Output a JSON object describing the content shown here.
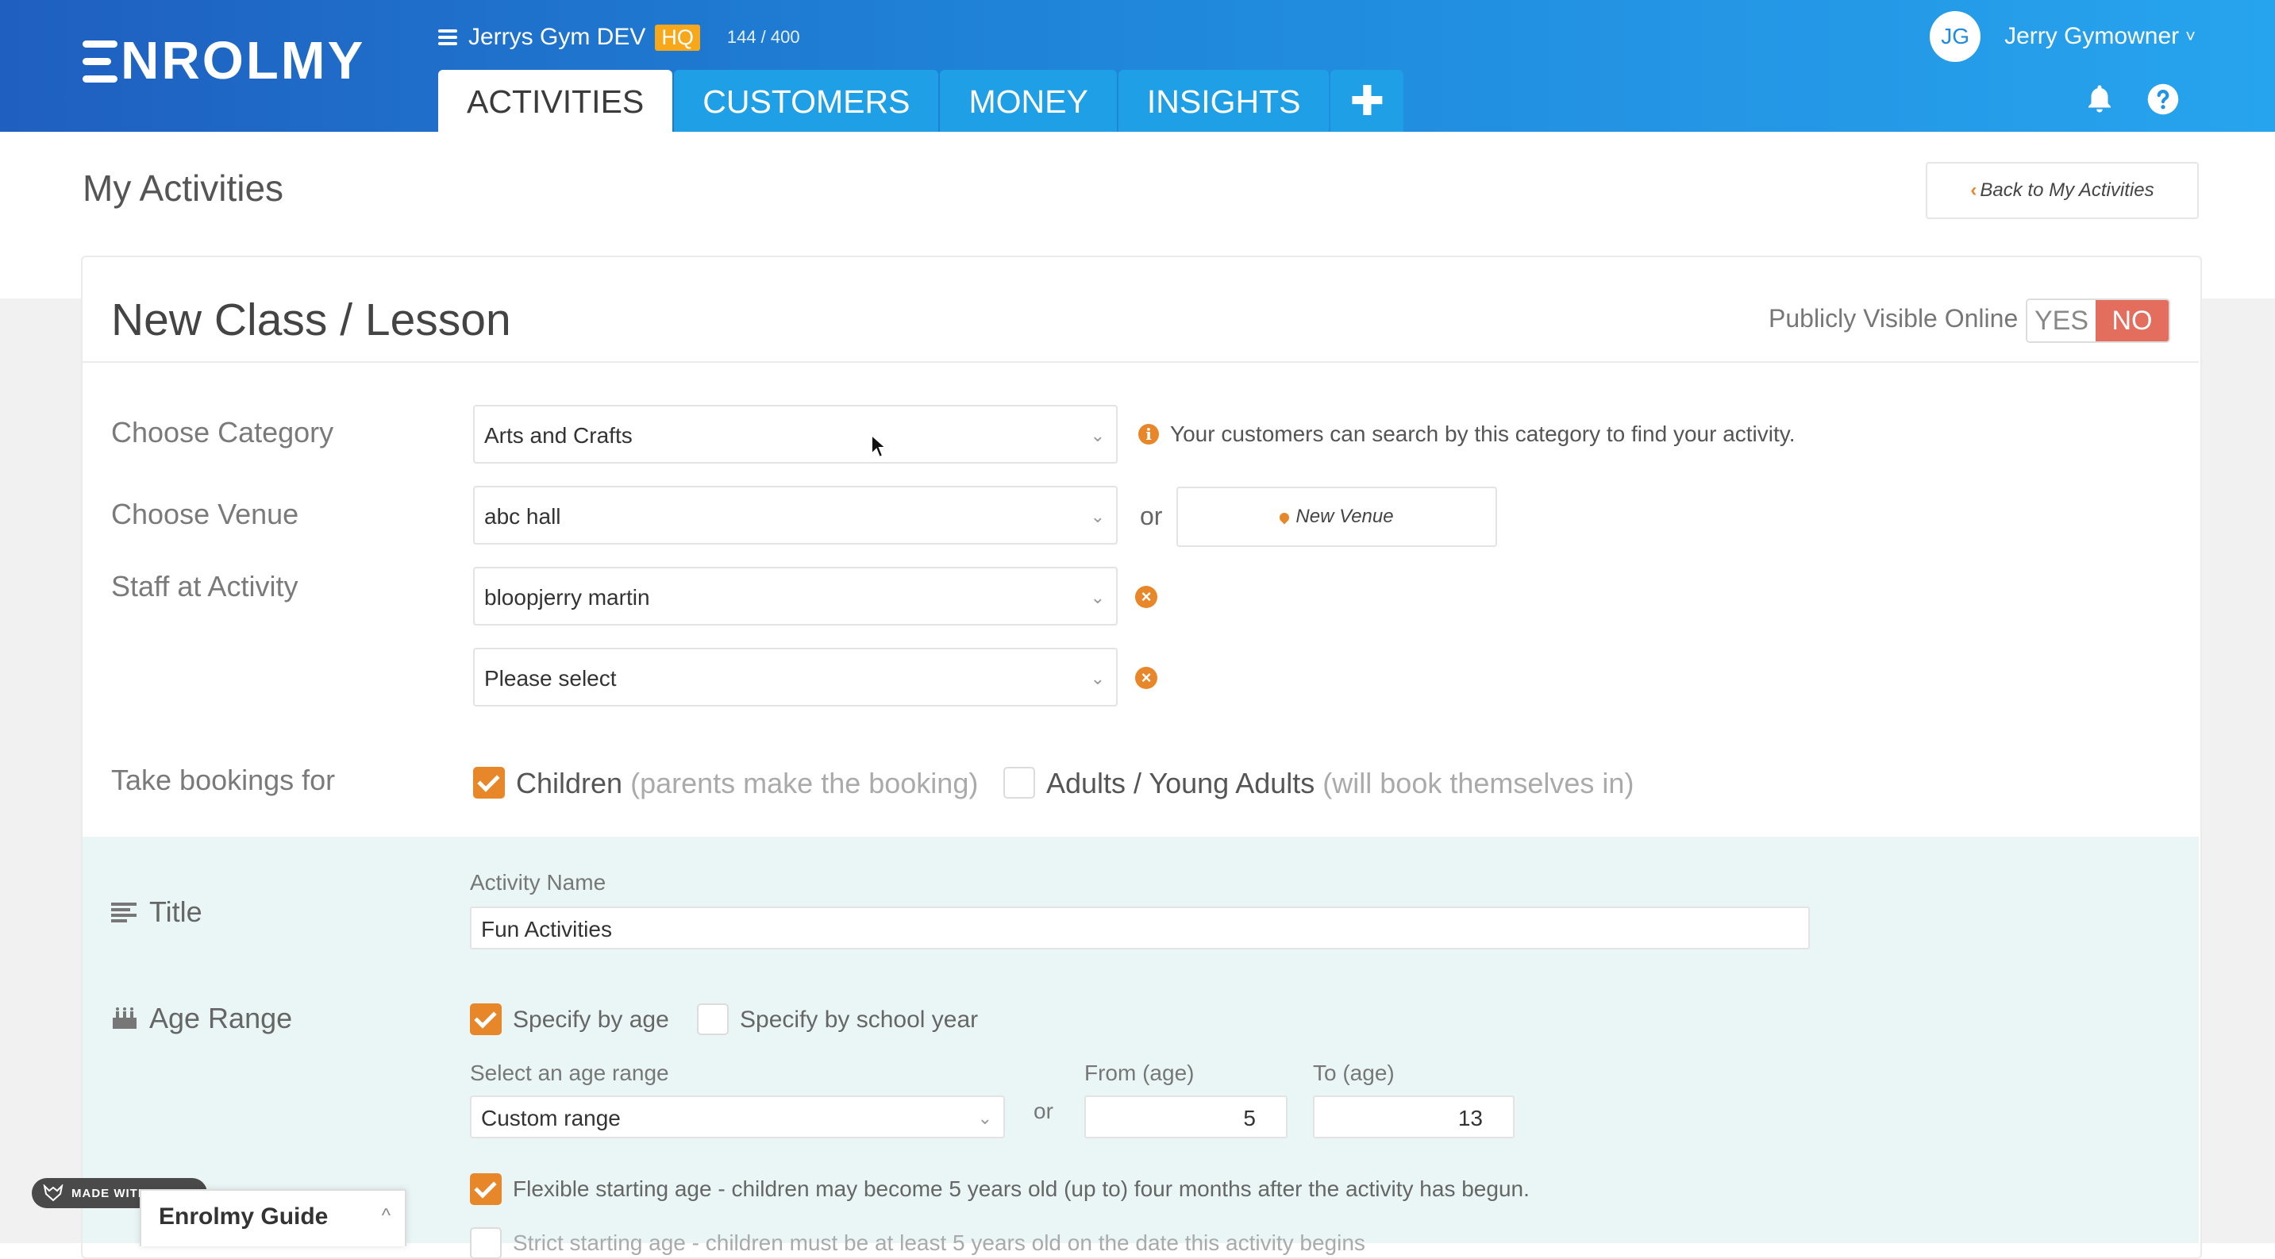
{
  "header": {
    "logo_text": "NROLMY",
    "org_name": "Jerrys Gym DEV",
    "org_badge": "HQ",
    "org_count": "144 / 400",
    "tabs": [
      {
        "label": "ACTIVITIES"
      },
      {
        "label": "CUSTOMERS"
      },
      {
        "label": "MONEY"
      },
      {
        "label": "INSIGHTS"
      },
      {
        "label": "✚"
      }
    ],
    "user_initials": "JG",
    "user_name": "Jerry Gymowner",
    "user_chevron": "˅"
  },
  "page": {
    "title": "My Activities",
    "back_chevron": "‹",
    "back_label": "Back to My Activities"
  },
  "form": {
    "title": "New Class / Lesson",
    "publicly_visible_label": "Publicly Visible Online",
    "visible_yes": "YES",
    "visible_no": "NO",
    "visible_value": "NO",
    "category_label": "Choose Category",
    "category_value": "Arts and Crafts",
    "category_info": "Your customers can search by this category to find your activity.",
    "info_icon": "i",
    "venue_label": "Choose Venue",
    "venue_value": "abc hall",
    "or_text": "or",
    "new_venue_label": "New Venue",
    "staff_label": "Staff at Activity",
    "staff_values": [
      "bloopjerry martin",
      "Please select"
    ],
    "remove_icon": "×",
    "bookings_label": "Take bookings for",
    "bookings_children": "Children",
    "bookings_children_hint": "(parents make the booking)",
    "bookings_children_checked": true,
    "bookings_adults": "Adults / Young Adults",
    "bookings_adults_hint": "(will book themselves in)",
    "bookings_adults_checked": false,
    "caret": "⌄"
  },
  "title_section": {
    "label": "Title",
    "activity_name_label": "Activity Name",
    "activity_name_value": "Fun Activities"
  },
  "age_section": {
    "label": "Age Range",
    "specify_by_age": "Specify by age",
    "specify_by_age_checked": true,
    "specify_by_school_year": "Specify by school year",
    "specify_by_school_year_checked": false,
    "select_range_label": "Select an age range",
    "select_range_value": "Custom range",
    "or_text": "or",
    "from_label": "From (age)",
    "from_value": "5",
    "to_label": "To (age)",
    "to_value": "13",
    "flexible_label": "Flexible starting age - children may become 5 years old (up to) four months after the activity has begun.",
    "flexible_checked": true,
    "strict_label": "Strict starting age - children must be at least 5 years old on the date this activity begins",
    "strict_checked": false
  },
  "overlay": {
    "gifox_label": "MADE WITH GIFOX",
    "guide_label": "Enrolmy Guide",
    "guide_chevron": "^"
  },
  "colors": {
    "header_gradient_start": "#1f5fbf",
    "header_gradient_end": "#27a4ee",
    "accent_orange": "#e8862a",
    "toggle_no_red": "#e46e5e",
    "hq_badge": "#f6a81a",
    "section_teal": "#eaf6f5"
  },
  "icons": [
    "menu-icon",
    "bell-icon",
    "help-icon",
    "info-icon",
    "map-pin-icon",
    "remove-icon",
    "lines-icon",
    "cake-icon",
    "chevron-left-icon",
    "chevron-down-icon",
    "chevron-up-icon"
  ]
}
